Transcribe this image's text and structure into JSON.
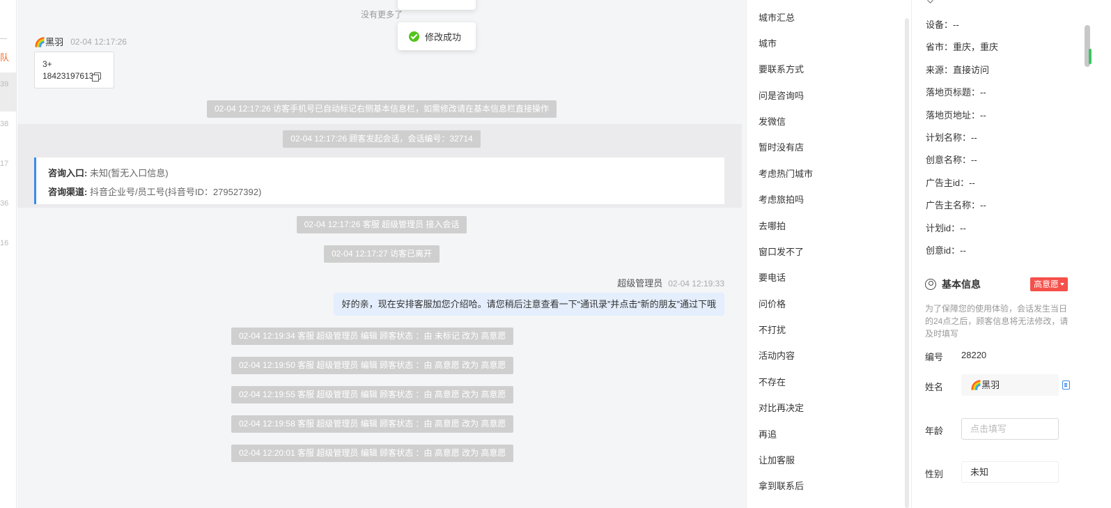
{
  "left_strip": {
    "tab_char": "队",
    "numbers": [
      "39",
      "38",
      "17",
      "36",
      "16"
    ]
  },
  "toast": {
    "message": "修改成功",
    "icon": "success-check-icon",
    "color": "#52c41a"
  },
  "chat": {
    "no_more_text": "没有更多了",
    "visitor": {
      "name": "🌈黑羽",
      "time": "02-04 12:17:26"
    },
    "phone_card": {
      "line1": "3+",
      "phone": "18423197613"
    },
    "system_messages": [
      "02-04 12:17:26 访客手机号已自动标记右侧基本信息栏，如需修改请在基本信息栏直接操作",
      "02-04 12:17:26 顾客发起会话，会话编号：32714"
    ],
    "entry_card": {
      "entry_label": "咨询入口:",
      "entry_value": "未知(暂无入口信息)",
      "channel_label": "咨询渠道:",
      "channel_value": "抖音企业号/员工号(抖音号ID：279527392)"
    },
    "system_messages_2": [
      "02-04 12:17:26 客服 超级管理员 接入会话",
      "02-04 12:17:27 访客已离开"
    ],
    "agent": {
      "name": "超级管理员",
      "time": "02-04 12:19:33",
      "message": "好的亲，现在安排客服加您介绍哈。请您稍后注意查看一下“通讯录”并点击“新的朋友”通过下哦"
    },
    "edit_logs": [
      "02-04 12:19:34 客服 超级管理员 编辑 顾客状态 ：由 未标记 改为 高意愿",
      "02-04 12:19:50 客服 超级管理员 编辑 顾客状态 ：由 高意愿 改为 高意愿",
      "02-04 12:19:55 客服 超级管理员 编辑 顾客状态 ：由 高意愿 改为 高意愿",
      "02-04 12:19:58 客服 超级管理员 编辑 顾客状态 ：由 高意愿 改为 高意愿",
      "02-04 12:20:01 客服 超级管理员 编辑 顾客状态 ：由 高意愿 改为 高意愿"
    ]
  },
  "quick_tags": [
    "城市汇总",
    "城市",
    "要联系方式",
    "问是咨询吗",
    "发微信",
    "暂时没有店",
    "考虑热门城市",
    "考虑旅拍吗",
    "去哪拍",
    "窗口发不了",
    "要电话",
    "问价格",
    "不打扰",
    "活动内容",
    "不存在",
    "对比再决定",
    "再追",
    "让加客服",
    "拿到联系后"
  ],
  "visitor_info": {
    "rows": [
      "设备：--",
      "省市：重庆，重庆",
      "来源：直接访问",
      "落地页标题：--",
      "落地页地址：--",
      "计划名称：--",
      "创意名称：--",
      "广告主id：--",
      "广告主名称：--",
      "计划id：--",
      "创意id：--"
    ]
  },
  "basic_info": {
    "title": "基本信息",
    "intent_badge": "高意愿",
    "badge_color": "#f5504a",
    "notice": "为了保障您的使用体验，会话发生当日的24点之后，顾客信息将无法修改，请及时填写",
    "id_label": "编号",
    "id_value": "28220",
    "name_label": "姓名",
    "name_value": "🌈黑羽",
    "age_label": "年龄",
    "age_placeholder": "点击填写",
    "gender_label": "性别",
    "gender_value": "未知"
  }
}
